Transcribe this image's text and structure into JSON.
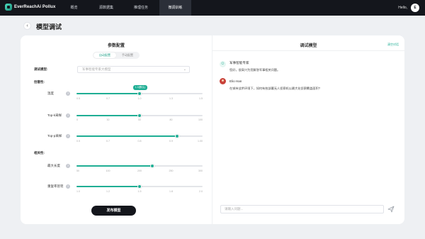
{
  "header": {
    "brand": "EverReachAi Pollux",
    "nav": [
      {
        "label": "概览",
        "active": false
      },
      {
        "label": "源数据集",
        "active": false
      },
      {
        "label": "推理任务",
        "active": false
      },
      {
        "label": "微调训练",
        "active": true
      }
    ],
    "greeting": "Hello,",
    "avatar_initial": "E"
  },
  "page": {
    "title": "模型调试",
    "back_icon": "chevron-left-icon"
  },
  "config": {
    "title": "参数配置",
    "tabs": [
      {
        "label": "自动配置",
        "active": true
      },
      {
        "label": "手动配置",
        "active": false
      }
    ],
    "model_label": "调试模型:",
    "model_placeholder": "军事智能专家大模型",
    "creativity_label": "创意性:",
    "relevance_label": "相关性:",
    "params": [
      {
        "label": "温度",
        "value": 1.0,
        "min": 0.5,
        "max": 1.5,
        "ticks": [
          "0.5",
          "0.7",
          "1.0",
          "1.3",
          "1.5"
        ],
        "value_label": "1.0(默认)"
      },
      {
        "label": "Top-k采样",
        "value": 50,
        "min": 0,
        "max": 100,
        "ticks": [
          "0",
          "30",
          "50",
          "80",
          "100"
        ]
      },
      {
        "label": "Top-p采样",
        "value": 0.9,
        "min": 0.5,
        "max": 1.0,
        "ticks": [
          "0.5",
          "0.7",
          "0.8",
          "0.9",
          "1.00"
        ]
      },
      {
        "label": "最大长度",
        "value": 200,
        "min": 50,
        "max": 300,
        "ticks": [
          "50",
          "100",
          "200",
          "250",
          "300"
        ]
      },
      {
        "label": "重复率惩罚",
        "value": 1.5,
        "min": 1.0,
        "max": 2.0,
        "ticks": [
          "1.0",
          "1.2",
          "1.5",
          "1.8",
          "2.0"
        ]
      }
    ],
    "publish_label": "发布模型"
  },
  "chat": {
    "title": "调试模型",
    "clear_label": "清空对话",
    "messages": [
      {
        "name": "军事智能专家",
        "text": "您好，很高兴为您解答军事相关问题。",
        "avatar": "bot-icon"
      },
      {
        "name": "Elio Han",
        "text": "在城市战术环境下，如何有效部署无人侦察机以最大化侦察覆盖面积?",
        "avatar": "user-avatar"
      }
    ],
    "input_placeholder": "请输入问题...",
    "send_icon": "send-icon"
  },
  "colors": {
    "accent": "#1fae94",
    "nav_bg": "#14161c"
  }
}
